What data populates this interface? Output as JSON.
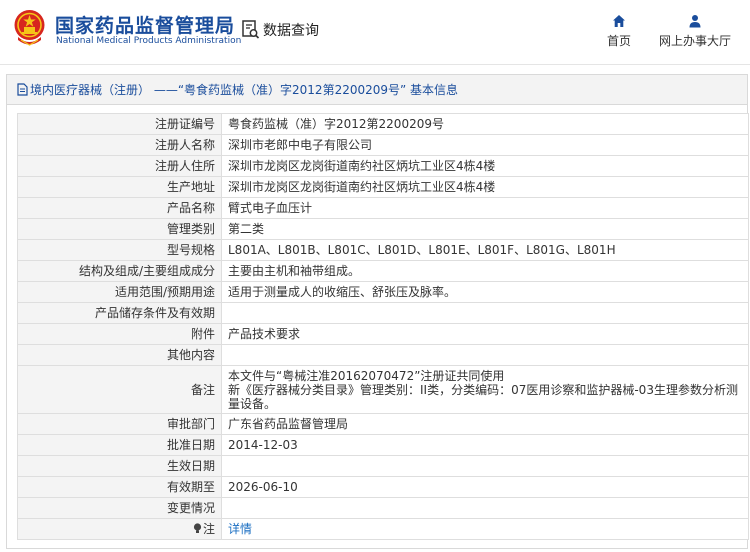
{
  "header": {
    "org_cn": "国家药品监督管理局",
    "org_en": "National Medical Products Administration",
    "query_label": "数据查询",
    "nav": [
      {
        "label": "首页",
        "icon": "home-icon"
      },
      {
        "label": "网上办事大厅",
        "icon": "user-icon"
      }
    ]
  },
  "panel": {
    "title": "境内医疗器械（注册） ——“粤食药监械（准）字2012第2200209号” 基本信息"
  },
  "rows": [
    {
      "label": "注册证编号",
      "value": "粤食药监械（准）字2012第2200209号"
    },
    {
      "label": "注册人名称",
      "value": "深圳市老郎中电子有限公司"
    },
    {
      "label": "注册人住所",
      "value": "深圳市龙岗区龙岗街道南约社区炳坑工业区4栋4楼"
    },
    {
      "label": "生产地址",
      "value": "深圳市龙岗区龙岗街道南约社区炳坑工业区4栋4楼"
    },
    {
      "label": "产品名称",
      "value": "臂式电子血压计"
    },
    {
      "label": "管理类别",
      "value": "第二类"
    },
    {
      "label": "型号规格",
      "value": "L801A、L801B、L801C、L801D、L801E、L801F、L801G、L801H"
    },
    {
      "label": "结构及组成/主要组成成分",
      "value": "主要由主机和袖带组成。"
    },
    {
      "label": "适用范围/预期用途",
      "value": "适用于测量成人的收缩压、舒张压及脉率。"
    },
    {
      "label": "产品储存条件及有效期",
      "value": ""
    },
    {
      "label": "附件",
      "value": "产品技术要求"
    },
    {
      "label": "其他内容",
      "value": ""
    },
    {
      "label": "备注",
      "value_lines": [
        "本文件与“粤械注准20162070472”注册证共同使用",
        "新《医疗器械分类目录》管理类别：II类，分类编码：07医用诊察和监护器械-03生理参数分析测量设备。"
      ]
    },
    {
      "label": "审批部门",
      "value": "广东省药品监督管理局"
    },
    {
      "label": "批准日期",
      "value": "2014-12-03"
    },
    {
      "label": "生效日期",
      "value": ""
    },
    {
      "label": "有效期至",
      "value": "2026-06-10"
    },
    {
      "label": "变更情况",
      "value": ""
    },
    {
      "label": "注",
      "value": "详情",
      "label_icon": "lightbulb-icon"
    }
  ],
  "colors": {
    "brand_blue": "#1a4d9c",
    "link_blue": "#1a6ec2",
    "emblem_red": "#d7261e",
    "emblem_gold": "#f5c518"
  }
}
